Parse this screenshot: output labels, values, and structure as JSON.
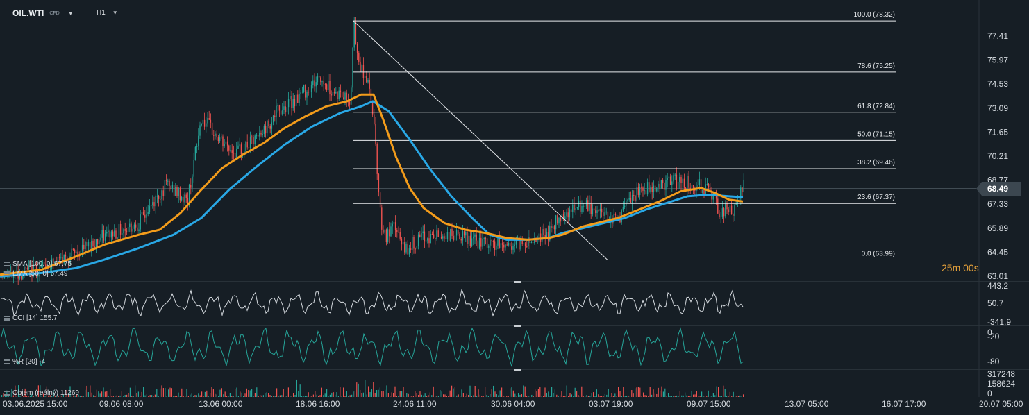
{
  "header": {
    "symbol": "OIL.WTI",
    "symbol_type": "CFD",
    "timeframe": "H1"
  },
  "current_price": "68.49",
  "countdown": "25m 00s",
  "indicators": {
    "sma": "SMA [100, 0] 67.75",
    "ema": "EMA [50, 0] 67.49",
    "cci": "CCI [14] 155.7",
    "wr": "%R [20] -4",
    "volume": "Objem (reálný) 11269"
  },
  "colors": {
    "background": "#161e25",
    "bull": "#26a69a",
    "bear": "#ef5350",
    "sma": "#29a8e6",
    "ema": "#f39c1b",
    "cci": "#d6dbe0",
    "wr": "#26a69a",
    "fib": "#e6e9ec"
  },
  "chart_data": {
    "type": "candlestick",
    "x_ticks": [
      "03.06.2025 15:00",
      "09.06 08:00",
      "13.06 00:00",
      "18.06 16:00",
      "24.06 11:00",
      "30.06 04:00",
      "03.07 19:00",
      "09.07 15:00",
      "13.07 05:00",
      "16.07 17:00",
      "20.07 05:00"
    ],
    "y_ticks": [
      "77.41",
      "75.97",
      "74.53",
      "73.09",
      "71.65",
      "70.21",
      "68.77",
      "67.33",
      "65.89",
      "64.45",
      "63.01"
    ],
    "ylim": [
      63.01,
      77.41
    ],
    "price_path": [
      [
        0,
        63.1
      ],
      [
        25,
        63.2
      ],
      [
        60,
        63.5
      ],
      [
        110,
        64.4
      ],
      [
        150,
        65.4
      ],
      [
        200,
        66.2
      ],
      [
        240,
        68.5
      ],
      [
        270,
        67.5
      ],
      [
        290,
        72.5
      ],
      [
        320,
        71.0
      ],
      [
        340,
        70.4
      ],
      [
        370,
        71.2
      ],
      [
        400,
        72.9
      ],
      [
        430,
        73.8
      ],
      [
        460,
        74.9
      ],
      [
        480,
        74.1
      ],
      [
        505,
        73.6
      ],
      [
        509,
        78.3
      ],
      [
        515,
        76.0
      ],
      [
        528,
        74.9
      ],
      [
        538,
        72.8
      ],
      [
        548,
        66.5
      ],
      [
        556,
        65.3
      ],
      [
        570,
        66.0
      ],
      [
        580,
        64.6
      ],
      [
        610,
        65.3
      ],
      [
        650,
        65.5
      ],
      [
        700,
        64.9
      ],
      [
        740,
        64.9
      ],
      [
        790,
        65.6
      ],
      [
        810,
        66.8
      ],
      [
        840,
        67.2
      ],
      [
        870,
        66.8
      ],
      [
        890,
        66.4
      ],
      [
        905,
        67.4
      ],
      [
        925,
        68.2
      ],
      [
        950,
        68.5
      ],
      [
        975,
        68.7
      ],
      [
        1000,
        68.5
      ],
      [
        1020,
        68.3
      ],
      [
        1035,
        67.0
      ],
      [
        1060,
        66.9
      ],
      [
        1070,
        68.5
      ]
    ],
    "sma_100": [
      [
        0,
        63.0
      ],
      [
        60,
        63.2
      ],
      [
        110,
        63.5
      ],
      [
        150,
        64.0
      ],
      [
        200,
        64.7
      ],
      [
        250,
        65.5
      ],
      [
        290,
        66.5
      ],
      [
        330,
        68.2
      ],
      [
        370,
        69.6
      ],
      [
        410,
        70.9
      ],
      [
        450,
        72.0
      ],
      [
        490,
        72.8
      ],
      [
        520,
        73.2
      ],
      [
        537,
        73.5
      ],
      [
        560,
        72.9
      ],
      [
        590,
        71.2
      ],
      [
        620,
        69.4
      ],
      [
        650,
        67.8
      ],
      [
        680,
        66.5
      ],
      [
        705,
        65.5
      ],
      [
        730,
        65.2
      ],
      [
        760,
        65.2
      ],
      [
        790,
        65.3
      ],
      [
        810,
        65.6
      ],
      [
        840,
        65.9
      ],
      [
        870,
        66.2
      ],
      [
        900,
        66.5
      ],
      [
        930,
        67.0
      ],
      [
        960,
        67.4
      ],
      [
        990,
        67.8
      ],
      [
        1020,
        67.9
      ],
      [
        1050,
        67.8
      ],
      [
        1070,
        67.75
      ]
    ],
    "ema_50": [
      [
        0,
        63.1
      ],
      [
        60,
        63.4
      ],
      [
        110,
        64.2
      ],
      [
        150,
        64.9
      ],
      [
        200,
        65.5
      ],
      [
        230,
        65.8
      ],
      [
        260,
        66.8
      ],
      [
        290,
        68.2
      ],
      [
        320,
        69.5
      ],
      [
        350,
        70.3
      ],
      [
        380,
        71.0
      ],
      [
        410,
        71.9
      ],
      [
        440,
        72.6
      ],
      [
        470,
        73.2
      ],
      [
        500,
        73.5
      ],
      [
        520,
        73.9
      ],
      [
        538,
        73.9
      ],
      [
        552,
        72.4
      ],
      [
        570,
        70.2
      ],
      [
        590,
        68.3
      ],
      [
        610,
        67.1
      ],
      [
        640,
        66.2
      ],
      [
        670,
        65.8
      ],
      [
        700,
        65.6
      ],
      [
        730,
        65.3
      ],
      [
        760,
        65.2
      ],
      [
        790,
        65.3
      ],
      [
        810,
        65.5
      ],
      [
        840,
        66.0
      ],
      [
        870,
        66.3
      ],
      [
        890,
        66.5
      ],
      [
        920,
        67.0
      ],
      [
        950,
        67.5
      ],
      [
        980,
        68.1
      ],
      [
        1010,
        68.3
      ],
      [
        1030,
        68.0
      ],
      [
        1050,
        67.6
      ],
      [
        1070,
        67.49
      ]
    ],
    "fib_levels": [
      {
        "label": "100.0 (78.32)",
        "value": 78.32
      },
      {
        "label": "78.6 (75.25)",
        "value": 75.25
      },
      {
        "label": "61.8 (72.84)",
        "value": 72.84
      },
      {
        "label": "50.0 (71.15)",
        "value": 71.15
      },
      {
        "label": "38.2 (69.46)",
        "value": 69.46
      },
      {
        "label": "23.6 (67.37)",
        "value": 67.37
      },
      {
        "label": "0.0 (63.99)",
        "value": 63.99
      }
    ],
    "cci_ticks": [
      "443.2",
      "50.7",
      "-341.9"
    ],
    "wr_ticks": [
      "0",
      "-20",
      "-80"
    ],
    "volume_ticks": [
      "317248",
      "158624",
      "0"
    ]
  }
}
